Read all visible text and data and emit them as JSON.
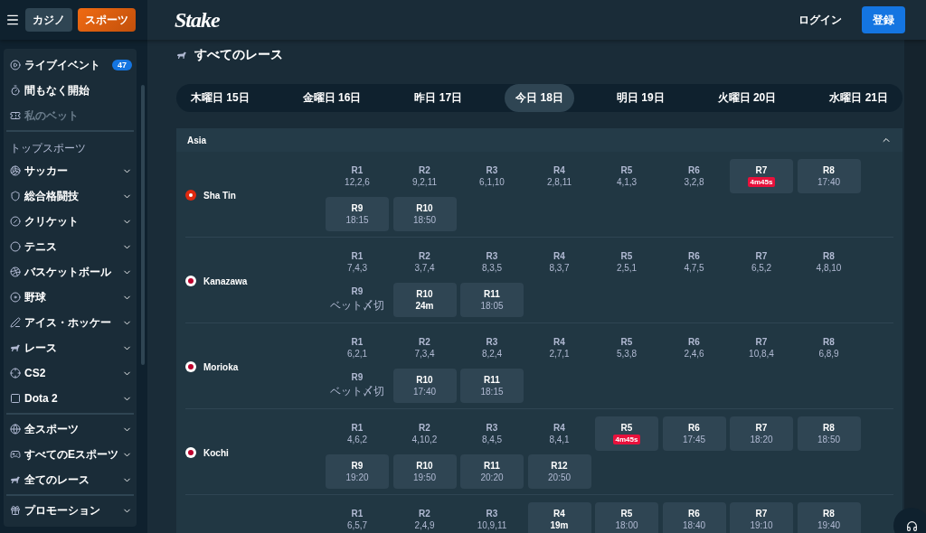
{
  "header": {
    "tabs": [
      {
        "label": "カジノ",
        "selected": false
      },
      {
        "label": "スポーツ",
        "selected": true
      }
    ],
    "logo": "Stake",
    "login": "ログイン",
    "register": "登録"
  },
  "sidebar": {
    "groups": [
      {
        "items": [
          {
            "kind": "link",
            "label": "ライブイベント",
            "badge": "47",
            "disabled": false
          },
          {
            "kind": "link",
            "label": "間もなく開始",
            "disabled": false
          },
          {
            "kind": "link",
            "label": "私のベット",
            "disabled": true
          }
        ]
      },
      {
        "heading": "トップスポーツ",
        "items": [
          {
            "kind": "dropdown",
            "label": "サッカー",
            "disabled": false
          },
          {
            "kind": "dropdown",
            "label": "総合格闘技",
            "disabled": false
          },
          {
            "kind": "dropdown",
            "label": "クリケット",
            "disabled": false
          },
          {
            "kind": "dropdown",
            "label": "テニス",
            "disabled": false
          },
          {
            "kind": "dropdown",
            "label": "バスケットボール",
            "disabled": false
          },
          {
            "kind": "dropdown",
            "label": "野球",
            "disabled": false
          },
          {
            "kind": "dropdown",
            "label": "アイス・ホッケー",
            "disabled": false
          },
          {
            "kind": "dropdown",
            "label": "レース",
            "disabled": false
          },
          {
            "kind": "dropdown",
            "label": "CS2",
            "disabled": false
          },
          {
            "kind": "dropdown",
            "label": "Dota 2",
            "disabled": false
          }
        ]
      },
      {
        "items": [
          {
            "kind": "dropdown",
            "label": "全スポーツ",
            "disabled": false
          },
          {
            "kind": "dropdown",
            "label": "すべてのEスポーツ",
            "disabled": false
          },
          {
            "kind": "dropdown",
            "label": "全てのレース",
            "disabled": false
          }
        ]
      },
      {
        "items": [
          {
            "kind": "dropdown",
            "label": "プロモーション",
            "disabled": false
          }
        ]
      }
    ]
  },
  "page_title": "すべてのレース",
  "days": [
    {
      "label": "木曜日 15日",
      "selected": false
    },
    {
      "label": "金曜日 16日",
      "selected": false
    },
    {
      "label": "昨日 17日",
      "selected": false
    },
    {
      "label": "今日 18日",
      "selected": true
    },
    {
      "label": "明日 19日",
      "selected": false
    },
    {
      "label": "火曜日 20日",
      "selected": false
    },
    {
      "label": "水曜日 21日",
      "selected": false
    }
  ],
  "region": {
    "name": "Asia",
    "expanded": true,
    "venues": [
      {
        "name": "Sha Tin",
        "kind": "hk",
        "races": [
          {
            "label": "R1",
            "info": "12,2,6",
            "kind": "result"
          },
          {
            "label": "R2",
            "info": "9,2,11",
            "kind": "result"
          },
          {
            "label": "R3",
            "info": "6,1,10",
            "kind": "result"
          },
          {
            "label": "R4",
            "info": "2,8,11",
            "kind": "result"
          },
          {
            "label": "R5",
            "info": "4,1,3",
            "kind": "result"
          },
          {
            "label": "R6",
            "info": "3,2,8",
            "kind": "result"
          },
          {
            "label": "R7",
            "info": "4m45s",
            "kind": "live"
          },
          {
            "label": "R8",
            "info": "17:40",
            "kind": "time"
          },
          {
            "label": "R9",
            "info": "18:15",
            "kind": "time"
          },
          {
            "label": "R10",
            "info": "18:50",
            "kind": "time"
          }
        ]
      },
      {
        "name": "Kanazawa",
        "kind": "jp",
        "races": [
          {
            "label": "R1",
            "info": "7,4,3",
            "kind": "result"
          },
          {
            "label": "R2",
            "info": "3,7,4",
            "kind": "result"
          },
          {
            "label": "R3",
            "info": "8,3,5",
            "kind": "result"
          },
          {
            "label": "R4",
            "info": "8,3,7",
            "kind": "result"
          },
          {
            "label": "R5",
            "info": "2,5,1",
            "kind": "result"
          },
          {
            "label": "R6",
            "info": "4,7,5",
            "kind": "result"
          },
          {
            "label": "R7",
            "info": "6,5,2",
            "kind": "result"
          },
          {
            "label": "R8",
            "info": "4,8,10",
            "kind": "result"
          },
          {
            "label": "R9",
            "info": "ベット〆切",
            "kind": "result"
          },
          {
            "label": "R10",
            "info": "24m",
            "kind": "soon"
          },
          {
            "label": "R11",
            "info": "18:05",
            "kind": "time"
          }
        ]
      },
      {
        "name": "Morioka",
        "kind": "jp",
        "races": [
          {
            "label": "R1",
            "info": "6,2,1",
            "kind": "result"
          },
          {
            "label": "R2",
            "info": "7,3,4",
            "kind": "result"
          },
          {
            "label": "R3",
            "info": "8,2,4",
            "kind": "result"
          },
          {
            "label": "R4",
            "info": "2,7,1",
            "kind": "result"
          },
          {
            "label": "R5",
            "info": "5,3,8",
            "kind": "result"
          },
          {
            "label": "R6",
            "info": "2,4,6",
            "kind": "result"
          },
          {
            "label": "R7",
            "info": "10,8,4",
            "kind": "result"
          },
          {
            "label": "R8",
            "info": "6,8,9",
            "kind": "result"
          },
          {
            "label": "R9",
            "info": "ベット〆切",
            "kind": "result"
          },
          {
            "label": "R10",
            "info": "17:40",
            "kind": "time"
          },
          {
            "label": "R11",
            "info": "18:15",
            "kind": "time"
          }
        ]
      },
      {
        "name": "Kochi",
        "kind": "jp",
        "races": [
          {
            "label": "R1",
            "info": "4,6,2",
            "kind": "result"
          },
          {
            "label": "R2",
            "info": "4,10,2",
            "kind": "result"
          },
          {
            "label": "R3",
            "info": "8,4,5",
            "kind": "result"
          },
          {
            "label": "R4",
            "info": "8,4,1",
            "kind": "result"
          },
          {
            "label": "R5",
            "info": "4m45s",
            "kind": "live"
          },
          {
            "label": "R6",
            "info": "17:45",
            "kind": "time"
          },
          {
            "label": "R7",
            "info": "18:20",
            "kind": "time"
          },
          {
            "label": "R8",
            "info": "18:50",
            "kind": "time"
          },
          {
            "label": "R9",
            "info": "19:20",
            "kind": "time"
          },
          {
            "label": "R10",
            "info": "19:50",
            "kind": "time"
          },
          {
            "label": "R11",
            "info": "20:20",
            "kind": "time"
          },
          {
            "label": "R12",
            "info": "20:50",
            "kind": "time"
          }
        ]
      },
      {
        "races": [
          {
            "label": "R1",
            "info": "6,5,7",
            "kind": "result"
          },
          {
            "label": "R2",
            "info": "2,4,9",
            "kind": "result"
          },
          {
            "label": "R3",
            "info": "10,9,11",
            "kind": "result"
          },
          {
            "label": "R4",
            "info": "19m",
            "kind": "soon"
          },
          {
            "label": "R5",
            "info": "18:00",
            "kind": "time"
          },
          {
            "label": "R6",
            "info": "18:40",
            "kind": "time"
          },
          {
            "label": "R7",
            "info": "19:10",
            "kind": "time"
          },
          {
            "label": "R8",
            "info": "19:40",
            "kind": "time"
          }
        ]
      }
    ]
  }
}
